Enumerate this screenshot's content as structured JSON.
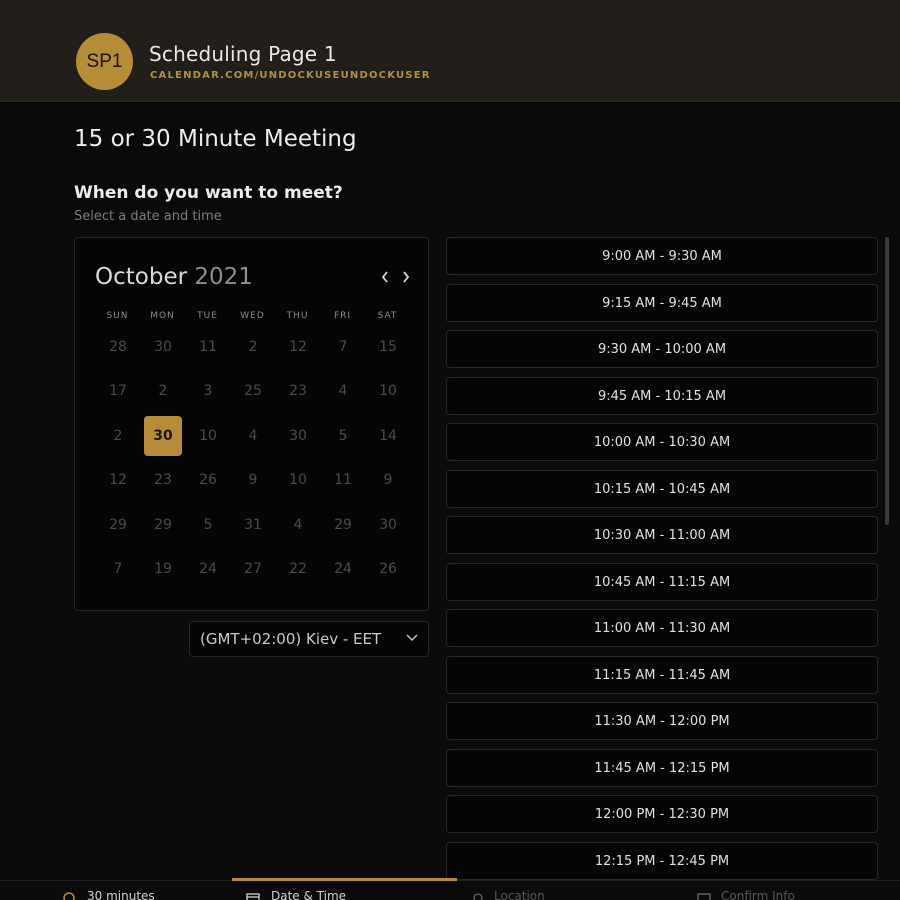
{
  "header": {
    "avatar_initials": "SP1",
    "title": "Scheduling Page 1",
    "url": "CALENDAR.COM/UNDOCKUSEUNDOCKUSER"
  },
  "meeting": {
    "title": "15 or 30 Minute Meeting",
    "question": "When do you want to meet?",
    "hint": "Select a date and time"
  },
  "calendar": {
    "month": "October",
    "year": "2021",
    "prev_icon": "chevron-left-icon",
    "next_icon": "chevron-right-icon",
    "weekdays": [
      "SUN",
      "MON",
      "TUE",
      "WED",
      "THU",
      "FRI",
      "SAT"
    ],
    "weeks": [
      [
        "28",
        "30",
        "11",
        "2",
        "12",
        "7",
        "15"
      ],
      [
        "17",
        "2",
        "3",
        "25",
        "23",
        "4",
        "10"
      ],
      [
        "2",
        "30",
        "10",
        "4",
        "30",
        "5",
        "14"
      ],
      [
        "12",
        "23",
        "26",
        "9",
        "10",
        "11",
        "9"
      ],
      [
        "29",
        "29",
        "5",
        "31",
        "4",
        "29",
        "30"
      ],
      [
        "7",
        "19",
        "24",
        "27",
        "22",
        "24",
        "26"
      ]
    ],
    "selected": "30"
  },
  "timezone": {
    "value": "(GMT+02:00) Kiev - EET",
    "icon": "chevron-down-icon"
  },
  "time_slots": [
    "9:00 AM - 9:30 AM",
    "9:15 AM - 9:45 AM",
    "9:30 AM - 10:00 AM",
    "9:45 AM - 10:15 AM",
    "10:00 AM - 10:30 AM",
    "10:15 AM - 10:45 AM",
    "10:30 AM - 11:00 AM",
    "10:45 AM - 11:15 AM",
    "11:00 AM - 11:30 AM",
    "11:15 AM - 11:45 AM",
    "11:30 AM - 12:00 PM",
    "11:45 AM - 12:15 PM",
    "12:00 PM - 12:30 PM",
    "12:15 PM - 12:45 PM"
  ],
  "steps": [
    {
      "label": "30 minutes",
      "icon": "clock-icon"
    },
    {
      "label": "Date & Time",
      "icon": "calendar-icon",
      "active": true
    },
    {
      "label": "Location",
      "icon": "location-icon"
    },
    {
      "label": "Confirm Info",
      "icon": "info-card-icon"
    }
  ],
  "colors": {
    "accent": "#b68d36",
    "background": "#0a0a0a",
    "header": "#221f1b"
  }
}
